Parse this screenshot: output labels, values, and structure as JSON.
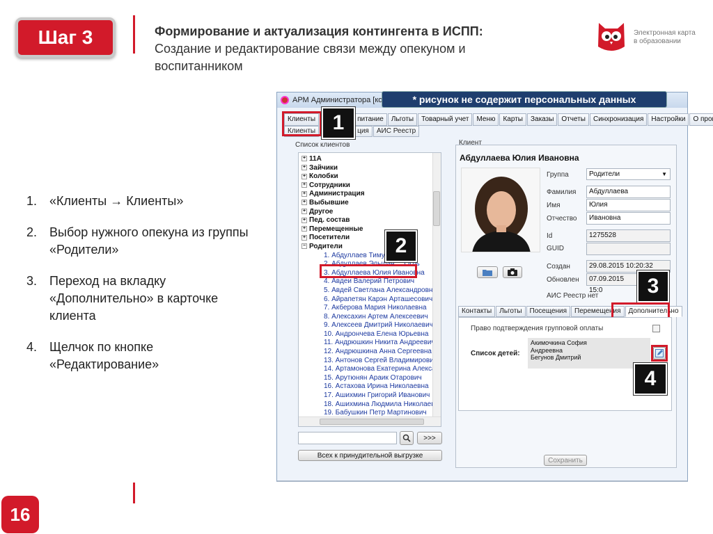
{
  "slide": {
    "step_badge": "Шаг 3",
    "title_bold": "Формирование и актуализация контингента в ИСПП:",
    "title_normal": "Создание и редактирование связи между опекуном и воспитанником",
    "logo_text_line1": "Электронная карта",
    "logo_text_line2": "в образовании",
    "page_number": "16",
    "steps": [
      {
        "num": "1.",
        "text": "«Клиенты → Клиенты»"
      },
      {
        "num": "2.",
        "text": "Выбор нужного опекуна из группы «Родители»"
      },
      {
        "num": "3.",
        "text": "Переход на вкладку «Дополнительно» в карточке клиента"
      },
      {
        "num": "4.",
        "text": "Щелчок по кнопке «Редактирование»"
      }
    ],
    "callouts": [
      "1",
      "2",
      "3",
      "4"
    ],
    "colors": {
      "accent": "#d21a2a",
      "note_bg": "#1f3e6e"
    }
  },
  "app": {
    "window_title": "АРМ Администратора [кон",
    "note": "* рисунок не содержит персональных данных",
    "menu": [
      "Клиенты",
      "питание",
      "Льготы",
      "Товарный учет",
      "Меню",
      "Карты",
      "Заказы",
      "Отчеты",
      "Синхронизация",
      "Настройки",
      "О прог"
    ],
    "submenu": [
      "Клиенты",
      "ция",
      "АИС Реестр"
    ],
    "client_list_label": "Список клиентов",
    "tree_groups": [
      "11А",
      "Зайчики",
      "Колобки",
      "Сотрудники",
      "Администрация",
      "Выбывшие",
      "Другое",
      "Пед. состав",
      "Перемещенные",
      "Посетители",
      "Родители"
    ],
    "tree_children": [
      "1. Абдуллаев Тимур ...",
      "2. Абдуллаев Эльшан ... Огль",
      "3. Абдуллаева Юлия Ивановна",
      "4. Авдеи Валерий Петрович",
      "5. Авдей Светлана Александровна",
      "6. Айрапетян Карэн Арташесович",
      "7. Акберова Мария Николаевна",
      "8. Алексахин Артем Алексеевич",
      "9. Алексеев Дмитрий Николаевич",
      "10. Андрончева Елена Юрьевна",
      "11. Андрюшкин Никита Андреевич",
      "12. Андрюшкина Анна Сергеевна",
      "13. Антонов Сергей Владимирович",
      "14. Артамонова Екатерина Александ",
      "15. Арутюнян Араик Отарович",
      "16. Астахова Ирина Николаевна",
      "17. Ашихмин Григорий Иванович",
      "18. Ашихмина Людмила Николаевна",
      "19. Бабушкин Петр Мартинович"
    ],
    "search_value": "",
    "search_icon": "magnifier-icon",
    "next_button": ">>>",
    "export_button": "Всех к принудительной выгрузке",
    "client_panel_label": "Клиент",
    "client_name": "Абдуллаева Юлия Ивановна",
    "fields": {
      "group_label": "Группа",
      "group_value": "Родители",
      "surname_label": "Фамилия",
      "surname_value": "Абдуллаева",
      "name_label": "Имя",
      "name_value": "Юлия",
      "patronymic_label": "Отчество",
      "patronymic_value": "Ивановна",
      "id_label": "Id",
      "id_value": "1275528",
      "guid_label": "GUID",
      "guid_value": "",
      "created_label": "Создан",
      "created_value": "29.08.2015 10:20:32",
      "updated_label": "Обновлен",
      "updated_value": "07.09.2015 15:0",
      "ais_label": "АИС Реестр",
      "ais_value": "нет"
    },
    "photo_buttons": [
      "folder-icon",
      "camera-icon"
    ],
    "card_tabs": [
      "Контакты",
      "Льготы",
      "Посещения",
      "Перемещения",
      "Дополнительно"
    ],
    "group_payment_label": "Право подтверждения групповой оплаты",
    "children_label": "Список детей:",
    "children": [
      "Акимочкина София",
      "Андреевна",
      "Бегунов Дмитрий"
    ],
    "edit_icon": "edit-icon",
    "save_button": "Сохранить"
  }
}
